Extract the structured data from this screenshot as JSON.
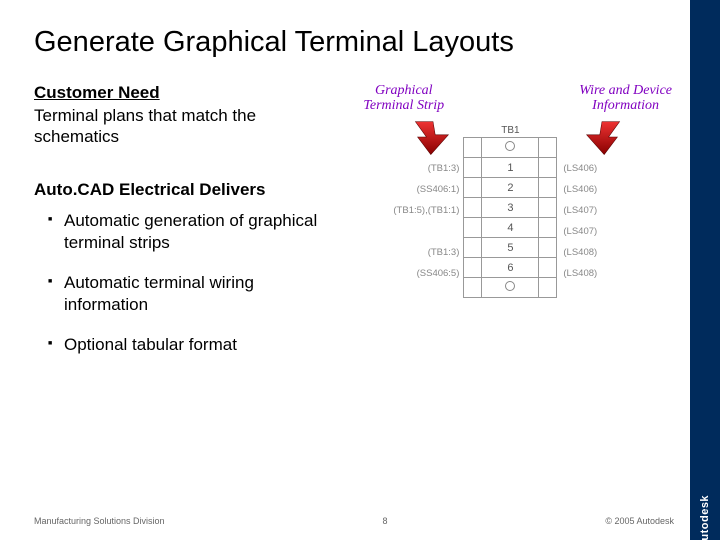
{
  "brand": "Autodesk",
  "title": "Generate Graphical Terminal Layouts",
  "need": {
    "heading": "Customer Need",
    "body": "Terminal plans that match the schematics"
  },
  "delivers": {
    "heading": "Auto.CAD Electrical Delivers",
    "bullets": [
      "Automatic generation of graphical terminal strips",
      "Automatic terminal wiring information",
      "Optional tabular format"
    ]
  },
  "diagram": {
    "callout_a_l1": "Graphical",
    "callout_a_l2": "Terminal Strip",
    "callout_b_l1": "Wire and Device",
    "callout_b_l2": "Information",
    "tb_label": "TB1",
    "rows": [
      "1",
      "2",
      "3",
      "4",
      "5",
      "6"
    ],
    "left_labels": [
      "(TB1:3)",
      "(SS406:1)",
      "(TB1:5),(TB1:1)",
      "(TB1:3)",
      "(SS406:5)"
    ],
    "right_labels": [
      "(LS406)",
      "(LS406)",
      "(LS407)",
      "(LS407)",
      "(LS408)",
      "(LS408)"
    ]
  },
  "footer": {
    "left": "Manufacturing Solutions Division",
    "center": "8",
    "right": "© 2005 Autodesk"
  }
}
